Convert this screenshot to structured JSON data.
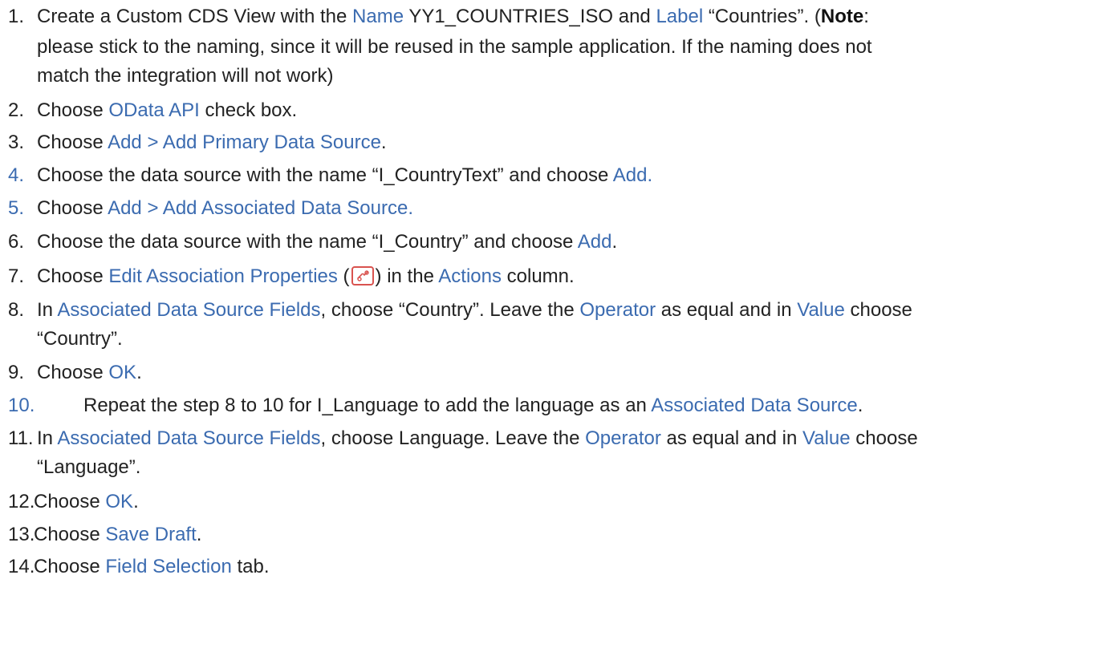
{
  "steps": [
    {
      "num": "1.",
      "num_color": "#222222",
      "lines": [
        [
          {
            "t": "Create a Custom CDS View with the ",
            "s": "plain"
          },
          {
            "t": "Name",
            "s": "link"
          },
          {
            "t": "  YY1_COUNTRIES_ISO and ",
            "s": "plain"
          },
          {
            "t": "Label",
            "s": "link"
          },
          {
            "t": " “Countries”. (",
            "s": "plain"
          },
          {
            "t": "Note",
            "s": "bold"
          },
          {
            "t": ":",
            "s": "plain"
          }
        ],
        [
          {
            "t": "please stick to the naming, since it will be reused in the sample application. If the naming does not",
            "s": "plain"
          }
        ],
        [
          {
            "t": "match the integration will not work)",
            "s": "plain"
          }
        ]
      ]
    },
    {
      "num": "2.",
      "num_color": "#222222",
      "lines": [
        [
          {
            "t": "Choose ",
            "s": "plain"
          },
          {
            "t": "OData API",
            "s": "link"
          },
          {
            "t": " check box.",
            "s": "plain"
          }
        ]
      ]
    },
    {
      "num": "3.",
      "num_color": "#222222",
      "lines": [
        [
          {
            "t": "Choose ",
            "s": "plain"
          },
          {
            "t": "Add > Add Primary Data Source",
            "s": "link"
          },
          {
            "t": ".",
            "s": "plain"
          }
        ]
      ]
    },
    {
      "num": "4.",
      "num_color": "#3b6bb0",
      "lines": [
        [
          {
            "t": "Choose the data source with the name “I_CountryText” and choose ",
            "s": "plain"
          },
          {
            "t": "Add.",
            "s": "link"
          }
        ]
      ]
    },
    {
      "num": "5.",
      "num_color": "#3b6bb0",
      "lines": [
        [
          {
            "t": "Choose ",
            "s": "plain"
          },
          {
            "t": "Add > Add Associated Data Source.",
            "s": "link"
          }
        ]
      ]
    },
    {
      "num": "6.",
      "num_color": "#222222",
      "lines": [
        [
          {
            "t": "Choose the data source with the name “I_Country” and choose ",
            "s": "plain"
          },
          {
            "t": "Add",
            "s": "link"
          },
          {
            "t": ".",
            "s": "plain"
          }
        ]
      ]
    },
    {
      "num": "7.",
      "num_color": "#222222",
      "lines": [
        [
          {
            "t": "Choose ",
            "s": "plain"
          },
          {
            "t": "Edit Association Properties",
            "s": "link"
          },
          {
            "t": " (",
            "s": "plain"
          },
          {
            "icon": "edit-association-icon"
          },
          {
            "t": ") in the ",
            "s": "plain"
          },
          {
            "t": "Actions",
            "s": "link"
          },
          {
            "t": " column.",
            "s": "plain"
          }
        ]
      ]
    },
    {
      "num": "8.",
      "num_color": "#222222",
      "lines": [
        [
          {
            "t": "In ",
            "s": "plain"
          },
          {
            "t": "Associated Data Source Fields",
            "s": "link"
          },
          {
            "t": ", choose “Country”. Leave the ",
            "s": "plain"
          },
          {
            "t": "Operator",
            "s": "link"
          },
          {
            "t": " as equal and in ",
            "s": "plain"
          },
          {
            "t": "Value",
            "s": "link"
          },
          {
            "t": " choose",
            "s": "plain"
          }
        ],
        [
          {
            "t": "“Country”.",
            "s": "plain"
          }
        ]
      ]
    },
    {
      "num": "9.",
      "num_color": "#222222",
      "lines": [
        [
          {
            "t": "Choose ",
            "s": "plain"
          },
          {
            "t": "OK",
            "s": "link"
          },
          {
            "t": ".",
            "s": "plain"
          }
        ]
      ]
    },
    {
      "num": "10.",
      "num_color": "#3b6bb0",
      "lines": [
        [
          {
            "t": "Repeat the step 8 to 10 for I_Language to add the language as an ",
            "s": "plain"
          },
          {
            "t": "Associated Data Source",
            "s": "link"
          },
          {
            "t": ".",
            "s": "plain"
          }
        ]
      ]
    },
    {
      "num": "11.",
      "num_color": "#222222",
      "lines": [
        [
          {
            "t": "In ",
            "s": "plain"
          },
          {
            "t": "Associated Data Source Fields",
            "s": "link"
          },
          {
            "t": ", choose Language. Leave the ",
            "s": "plain"
          },
          {
            "t": "Operator",
            "s": "link"
          },
          {
            "t": " as equal and in ",
            "s": "plain"
          },
          {
            "t": "Value",
            "s": "link"
          },
          {
            "t": " choose",
            "s": "plain"
          }
        ],
        [
          {
            "t": "“Language”.",
            "s": "plain"
          }
        ]
      ]
    },
    {
      "num": "12.",
      "num_color": "#222222",
      "lines": [
        [
          {
            "t": "Choose ",
            "s": "plain"
          },
          {
            "t": "OK",
            "s": "link"
          },
          {
            "t": ".",
            "s": "plain"
          }
        ]
      ]
    },
    {
      "num": "13.",
      "num_color": "#222222",
      "lines": [
        [
          {
            "t": "Choose ",
            "s": "plain"
          },
          {
            "t": "Save Draft",
            "s": "link"
          },
          {
            "t": ".",
            "s": "plain"
          }
        ]
      ]
    },
    {
      "num": "14.",
      "num_color": "#222222",
      "lines": [
        [
          {
            "t": "Choose ",
            "s": "plain"
          },
          {
            "t": "Field Selection",
            "s": "link"
          },
          {
            "t": " tab.",
            "s": "plain"
          }
        ]
      ]
    }
  ],
  "colors": {
    "text": "#222222",
    "link": "#3b6bb0",
    "icon_border": "#d9534f"
  }
}
